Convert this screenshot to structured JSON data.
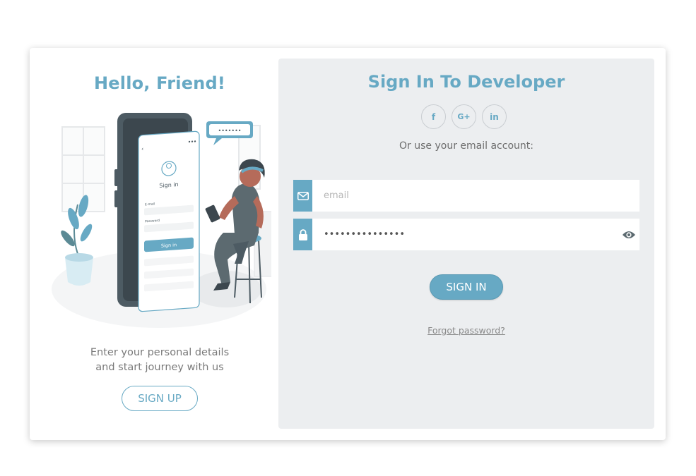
{
  "left_panel": {
    "heading": "Hello, Friend!",
    "tagline_line1": "Enter your personal details",
    "tagline_line2": "and start journey with us",
    "signup_label": "SIGN UP",
    "illustration": {
      "phone_title": "Sign in",
      "email_label": "E-mail",
      "password_label": "Password",
      "button_label": "Sign in"
    }
  },
  "right_panel": {
    "heading": "Sign In To Developer",
    "socials": [
      {
        "name": "facebook-icon",
        "glyph": "f"
      },
      {
        "name": "google-plus-icon",
        "glyph": "G+"
      },
      {
        "name": "linkedin-icon",
        "glyph": "in"
      }
    ],
    "alt_text": "Or use your email account:",
    "email": {
      "placeholder": "email",
      "value": ""
    },
    "password": {
      "value": "•••••••••••••••"
    },
    "signin_label": "SIGN IN",
    "forgot_label": "Forgot password?"
  },
  "colors": {
    "accent": "#67a9c4",
    "panel_bg": "#eceef0"
  }
}
